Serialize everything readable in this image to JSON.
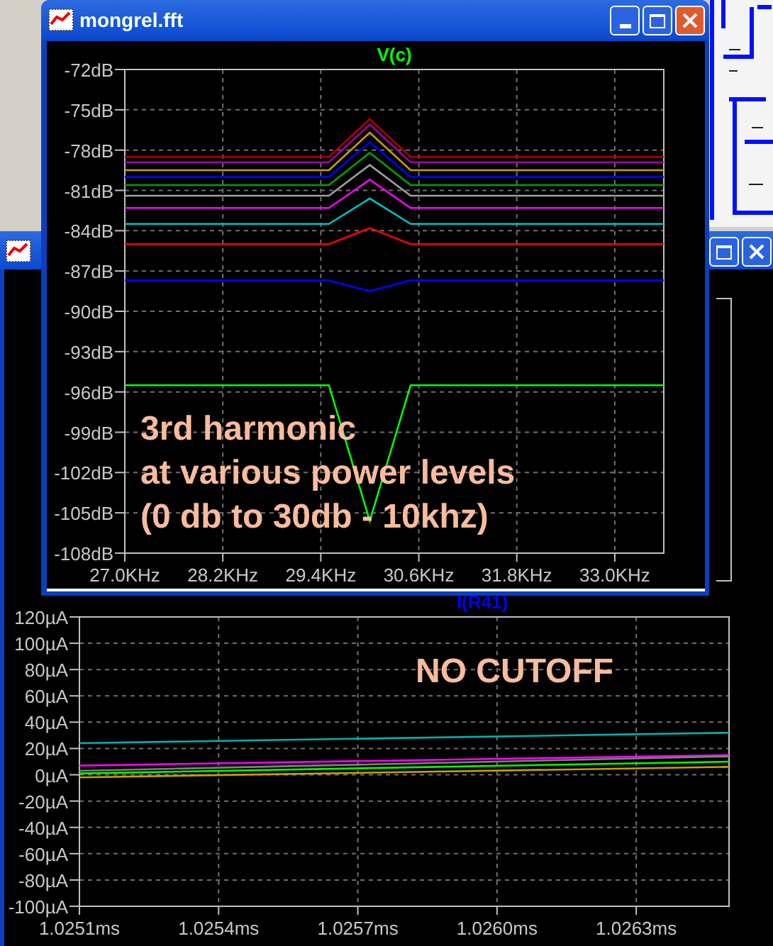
{
  "fft_window": {
    "title": "mongrel.fft",
    "chart_data": {
      "type": "line",
      "title": "V(c)",
      "grid": true,
      "x": [
        27.0,
        29.5,
        30.0,
        30.5,
        33.6
      ],
      "xlim": [
        27.0,
        33.6
      ],
      "ylim": [
        -108,
        -72
      ],
      "xticks": [
        {
          "value": 27.0,
          "label": "27.0KHz"
        },
        {
          "value": 28.2,
          "label": "28.2KHz"
        },
        {
          "value": 29.4,
          "label": "29.4KHz"
        },
        {
          "value": 30.6,
          "label": "30.6KHz"
        },
        {
          "value": 31.8,
          "label": "31.8KHz"
        },
        {
          "value": 33.0,
          "label": "33.0KHz"
        }
      ],
      "yticks": [
        {
          "value": -72,
          "label": "-72dB"
        },
        {
          "value": -75,
          "label": "-75dB"
        },
        {
          "value": -78,
          "label": "-78dB"
        },
        {
          "value": -81,
          "label": "-81dB"
        },
        {
          "value": -84,
          "label": "-84dB"
        },
        {
          "value": -87,
          "label": "-87dB"
        },
        {
          "value": -90,
          "label": "-90dB"
        },
        {
          "value": -93,
          "label": "-93dB"
        },
        {
          "value": -96,
          "label": "-96dB"
        },
        {
          "value": -99,
          "label": "-99dB"
        },
        {
          "value": -102,
          "label": "-102dB"
        },
        {
          "value": -105,
          "label": "-105dB"
        },
        {
          "value": -108,
          "label": "-108dB"
        }
      ],
      "series": [
        {
          "color": "#b00000",
          "values": [
            -78.5,
            -78.5,
            -75.7,
            -78.5,
            -78.5
          ]
        },
        {
          "color": "#a000a0",
          "values": [
            -78.9,
            -78.9,
            -76.1,
            -78.9,
            -78.9
          ]
        },
        {
          "color": "#c8a000",
          "values": [
            -79.5,
            -79.5,
            -76.7,
            -79.5,
            -79.5
          ]
        },
        {
          "color": "#0000ff",
          "values": [
            -80.0,
            -80.0,
            -77.4,
            -80.0,
            -80.0
          ]
        },
        {
          "color": "#00a000",
          "values": [
            -80.6,
            -80.6,
            -78.2,
            -80.6,
            -80.6
          ]
        },
        {
          "color": "#a0a0a0",
          "values": [
            -81.4,
            -81.4,
            -79.1,
            -81.4,
            -81.4
          ]
        },
        {
          "color": "#ff00ff",
          "values": [
            -82.3,
            -82.3,
            -80.2,
            -82.3,
            -82.3
          ]
        },
        {
          "color": "#00c0c0",
          "values": [
            -83.5,
            -83.5,
            -81.6,
            -83.5,
            -83.5
          ]
        },
        {
          "color": "#ff0000",
          "values": [
            -85.0,
            -85.0,
            -83.8,
            -85.0,
            -85.0
          ]
        },
        {
          "color": "#0000ff",
          "values": [
            -87.7,
            -87.7,
            -88.5,
            -87.7,
            -87.7
          ]
        },
        {
          "color": "#00ff00",
          "values": [
            -95.5,
            -95.5,
            -105.6,
            -95.5,
            -95.5
          ]
        }
      ],
      "annotations": [
        "3rd harmonic",
        "at various power levels",
        "(0 db to 30db - 10khz)"
      ]
    }
  },
  "back_window": {
    "chart_data": {
      "type": "line",
      "title": "I(R41)",
      "grid": true,
      "x": [
        1.0251,
        1.0265
      ],
      "xlim": [
        1.0251,
        1.0265
      ],
      "ylim": [
        -100,
        120
      ],
      "xticks": [
        {
          "value": 1.0251,
          "label": "1.0251ms"
        },
        {
          "value": 1.0254,
          "label": "1.0254ms"
        },
        {
          "value": 1.0257,
          "label": "1.0257ms"
        },
        {
          "value": 1.026,
          "label": "1.0260ms"
        },
        {
          "value": 1.0263,
          "label": "1.0263ms"
        }
      ],
      "yticks": [
        {
          "value": 120,
          "label": "120µA"
        },
        {
          "value": 100,
          "label": "100µA"
        },
        {
          "value": 80,
          "label": "80µA"
        },
        {
          "value": 60,
          "label": "60µA"
        },
        {
          "value": 40,
          "label": "40µA"
        },
        {
          "value": 20,
          "label": "20µA"
        },
        {
          "value": 0,
          "label": "0µA"
        },
        {
          "value": -20,
          "label": "-20µA"
        },
        {
          "value": -40,
          "label": "-40µA"
        },
        {
          "value": -60,
          "label": "-60µA"
        },
        {
          "value": -80,
          "label": "-80µA"
        },
        {
          "value": -100,
          "label": "-100µA"
        }
      ],
      "series": [
        {
          "color": "#00b0b0",
          "values": [
            24,
            32
          ]
        },
        {
          "color": "#ff00ff",
          "values": [
            7,
            15
          ]
        },
        {
          "color": "#808080",
          "values": [
            3,
            14
          ]
        },
        {
          "color": "#c8a000",
          "values": [
            -2,
            6
          ]
        },
        {
          "color": "#00ff00",
          "values": [
            1,
            10
          ]
        }
      ],
      "annotations": [
        "NO CUTOFF"
      ]
    }
  }
}
